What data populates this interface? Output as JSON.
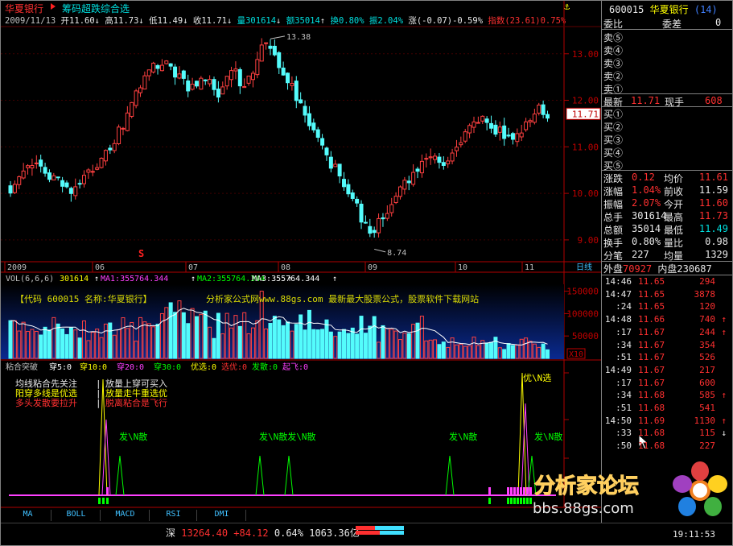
{
  "header": {
    "stock_name": "华夏银行",
    "formula_label": "筹码超跌综合选",
    "date": "2009/11/13",
    "open": "开11.60",
    "high": "高11.73",
    "low": "低11.49",
    "close": "收11.71",
    "volume": "量301614",
    "amount": "额35014",
    "turnover": "换0.80%",
    "amplitude": "振2.04%",
    "rise": "涨(-0.07)-0.59%",
    "index": "指数(23.61)0.75%",
    "anchor_icon_label": "⚓"
  },
  "chart_data": [
    {
      "type": "candlestick",
      "title": "",
      "price_axis_ticks": [
        9.0,
        10.0,
        11.0,
        12.0,
        13.0
      ],
      "max_label": "13.38",
      "min_label": "8.74",
      "current_price_label": "11.71",
      "time_axis_labels": [
        "2009",
        "06",
        "07",
        "08",
        "09",
        "10",
        "11",
        "日线"
      ],
      "marker_s": "S"
    },
    {
      "type": "bar",
      "title": "VOL(6,6,6)",
      "vol": "301614",
      "ma1_label": "MA1:355764.344",
      "ma2_label": "MA2:355764.344",
      "ma3_label": "MA3:355764.344",
      "y_ticks": [
        "150000",
        "100000",
        "50000",
        "X10"
      ],
      "overlay_text_left": "【代码 600015  名称:华夏银行】",
      "overlay_text_right": "分析家公式网www.88gs.com  最新最大股票公式，股票软件下载网站"
    },
    {
      "type": "line",
      "title": "粘合突破",
      "legend": [
        {
          "name": "穿5:",
          "value": "0"
        },
        {
          "name": "穿10:",
          "value": "0"
        },
        {
          "name": "穿20:",
          "value": "0"
        },
        {
          "name": "穿30:",
          "value": "0"
        },
        {
          "name": "优选:",
          "value": "0"
        },
        {
          "name": "选优:",
          "value": "0"
        },
        {
          "name": "发散:",
          "value": "0"
        },
        {
          "name": "起飞:",
          "value": "0"
        }
      ],
      "notes_left": [
        "均线粘合先关注",
        "阳穿多线是优选",
        "多头发散要拉升"
      ],
      "notes_right": [
        "放量上穿可买入",
        "放量走牛重选优",
        "脱离粘合是飞行"
      ],
      "signal_labels": [
        "发\\N散",
        "发\\N散发\\N散",
        "发\\N散",
        "优\\N选",
        "发\\N散"
      ]
    }
  ],
  "tabs": [
    "MA",
    "BOLL",
    "MACD",
    "RSI",
    "DMI"
  ],
  "right_panel": {
    "code": "600015",
    "name": "华夏银行",
    "count": "(14)",
    "ratio_label": "委比",
    "diff_label": "委差",
    "diff_value": "0",
    "sells": [
      "卖⑤",
      "卖④",
      "卖③",
      "卖②",
      "卖①"
    ],
    "latest_label": "最新",
    "latest_value": "11.71",
    "hand_label": "现手",
    "hand_value": "608",
    "buys": [
      "买①",
      "买②",
      "买③",
      "买④",
      "买⑤"
    ],
    "stats": [
      {
        "l1": "涨跌",
        "v1": "0.12",
        "l2": "均价",
        "v2": "11.61"
      },
      {
        "l1": "涨幅",
        "v1": "1.04%",
        "l2": "前收",
        "v2": "11.59"
      },
      {
        "l1": "振幅",
        "v1": "2.07%",
        "l2": "今开",
        "v2": "11.60"
      },
      {
        "l1": "总手",
        "v1": "301614",
        "l2": "最高",
        "v2": "11.73"
      },
      {
        "l1": "总额",
        "v1": "35014",
        "l2": "最低",
        "v2": "11.49"
      },
      {
        "l1": "换手",
        "v1": "0.80%",
        "l2": "量比",
        "v2": "0.98"
      },
      {
        "l1": "分笔",
        "v1": "227",
        "l2": "均量",
        "v2": "1329"
      }
    ],
    "outer_label": "外盘",
    "outer_value": "70927",
    "inner_label": "内盘",
    "inner_value": "230687",
    "ticks": [
      {
        "t": "14:46",
        "p": "11.65",
        "v": "294",
        "a": ""
      },
      {
        "t": "14:47",
        "p": "11.65",
        "v": "3878",
        "a": ""
      },
      {
        "t": ":24",
        "p": "11.65",
        "v": "120",
        "a": ""
      },
      {
        "t": "14:48",
        "p": "11.66",
        "v": "740",
        "a": "↑"
      },
      {
        "t": ":17",
        "p": "11.67",
        "v": "244",
        "a": "↑"
      },
      {
        "t": ":34",
        "p": "11.67",
        "v": "354",
        "a": ""
      },
      {
        "t": ":51",
        "p": "11.67",
        "v": "526",
        "a": ""
      },
      {
        "t": "14:49",
        "p": "11.67",
        "v": "217",
        "a": ""
      },
      {
        "t": ":17",
        "p": "11.67",
        "v": "600",
        "a": ""
      },
      {
        "t": ":34",
        "p": "11.68",
        "v": "585",
        "a": "↑"
      },
      {
        "t": ":51",
        "p": "11.68",
        "v": "541",
        "a": ""
      },
      {
        "t": "14:50",
        "p": "11.69",
        "v": "1130",
        "a": "↑"
      },
      {
        "t": ":33",
        "p": "11.68",
        "v": "115",
        "a": "↓"
      },
      {
        "t": ":50",
        "p": "11.68",
        "v": "227",
        "a": ""
      }
    ]
  },
  "status_bar": {
    "market": "深",
    "index_value": "13264.40",
    "change": "+84.12",
    "pct": "0.64%",
    "amount": "1063.36亿",
    "time": "19:11:53"
  },
  "watermark": {
    "title": "分析家论坛",
    "url": "bbs.88gs.com"
  }
}
